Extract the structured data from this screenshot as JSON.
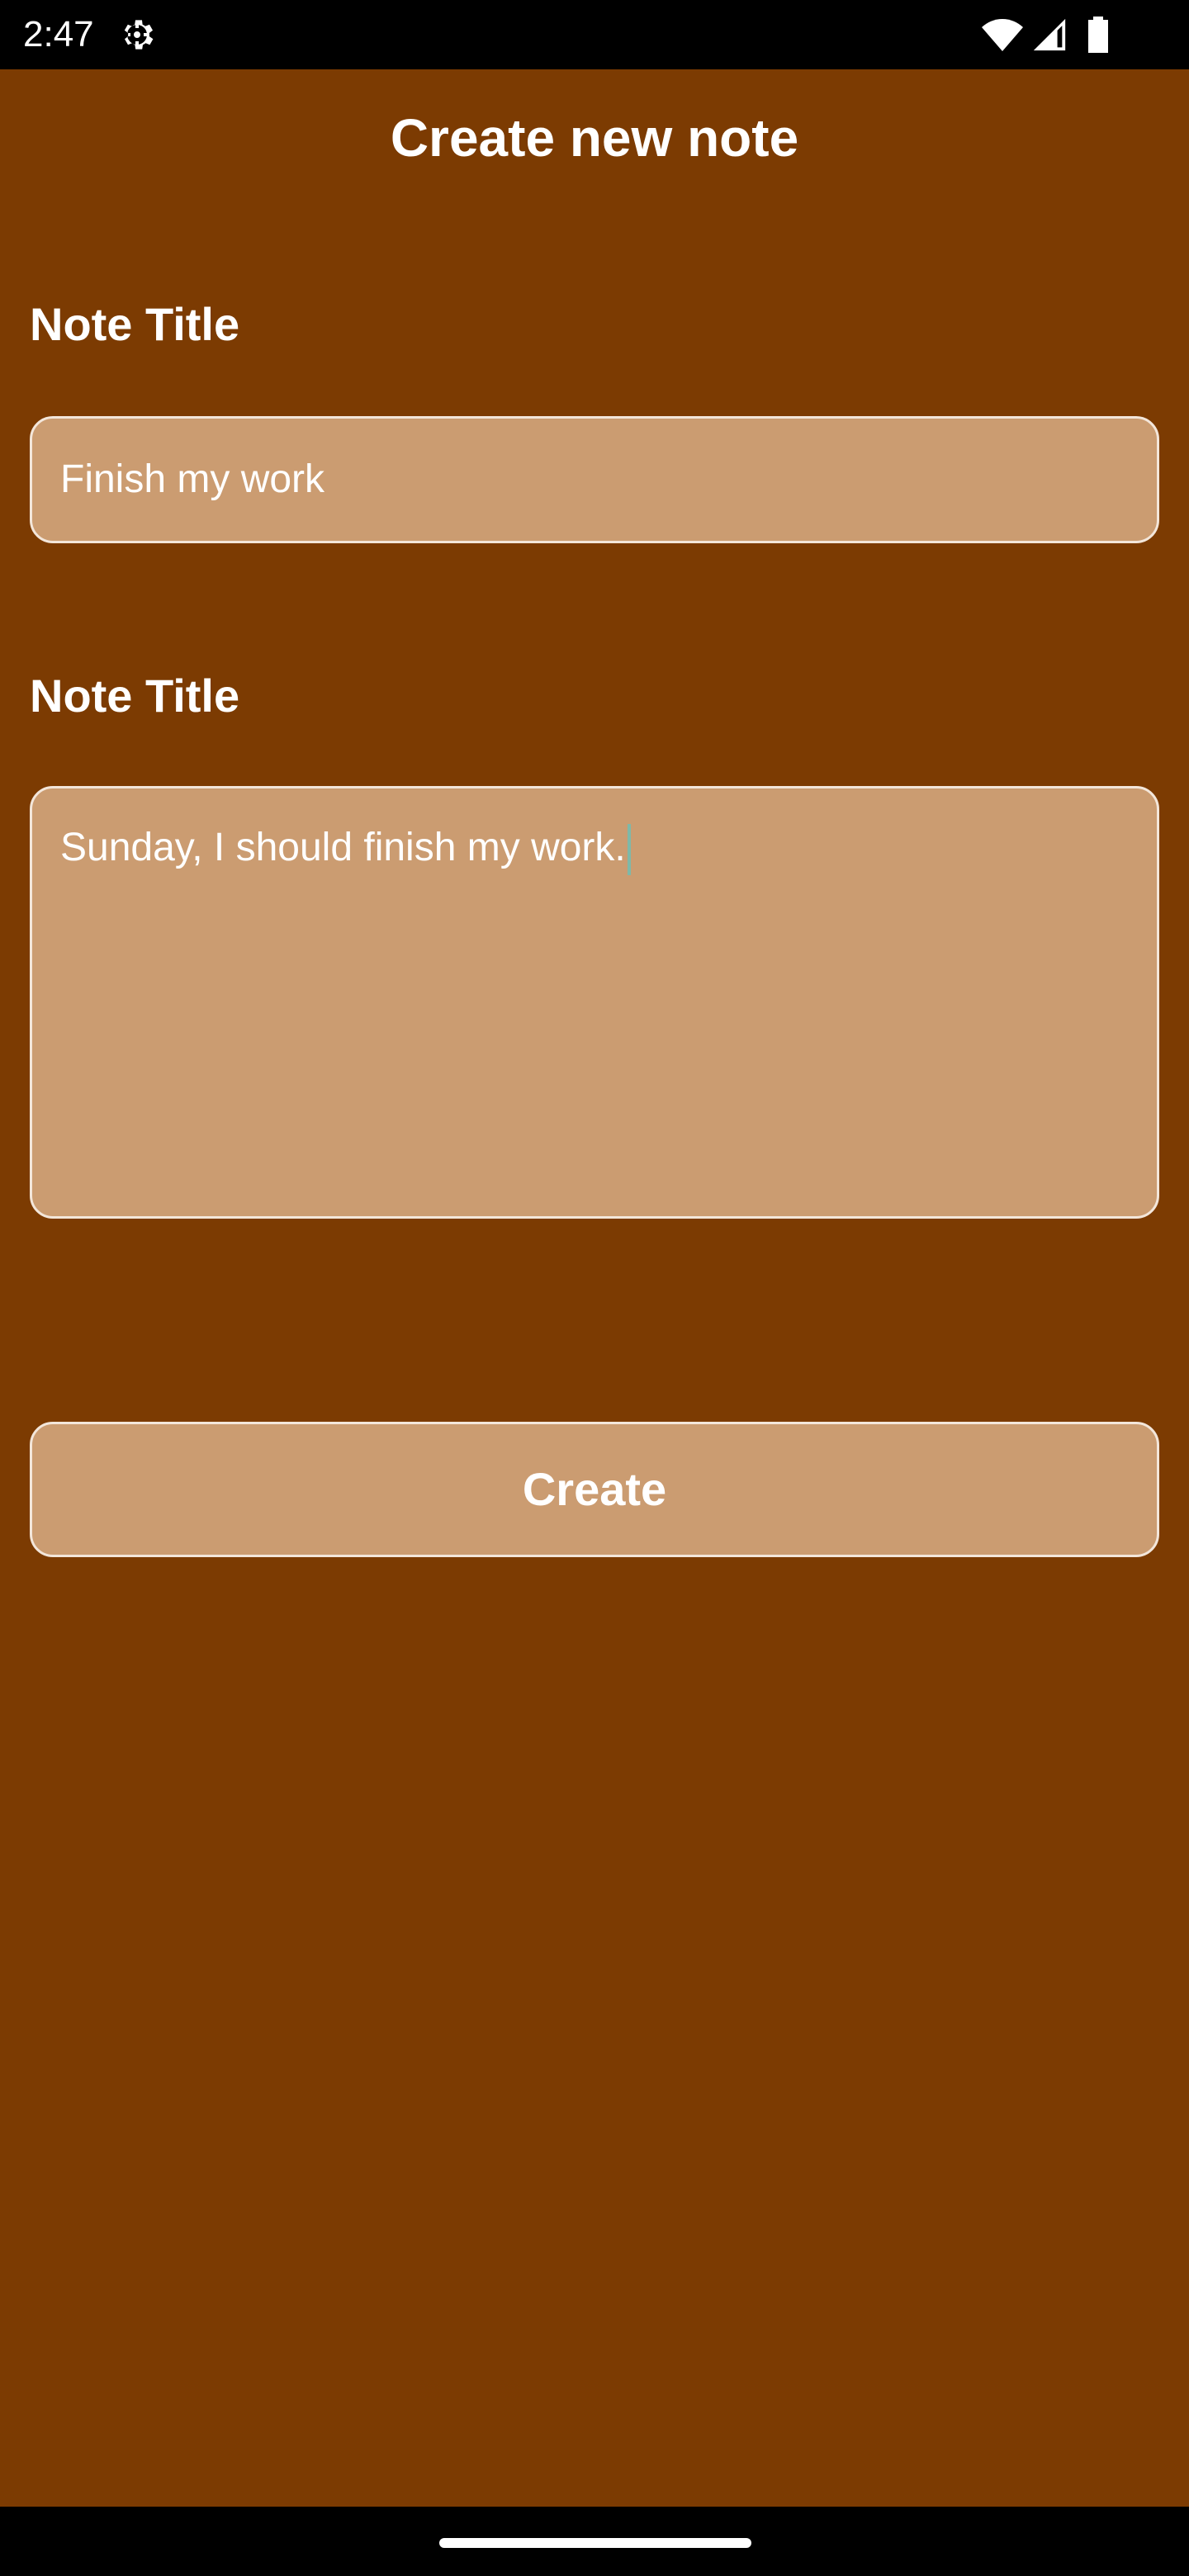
{
  "status_bar": {
    "time": "2:47",
    "icons": [
      "settings-gear-icon",
      "wifi-icon",
      "cell-signal-icon",
      "battery-icon"
    ]
  },
  "header": {
    "title": "Create new note"
  },
  "form": {
    "title_label": "Note Title",
    "title_value": "Finish my work",
    "content_label": "Note Title",
    "content_value": "Sunday, I should finish my work."
  },
  "actions": {
    "create_label": "Create"
  },
  "colors": {
    "background": "#7c3b02",
    "field_fill": "#cb9c71",
    "field_border": "#f3e6da",
    "caret": "#7fb8a8"
  }
}
